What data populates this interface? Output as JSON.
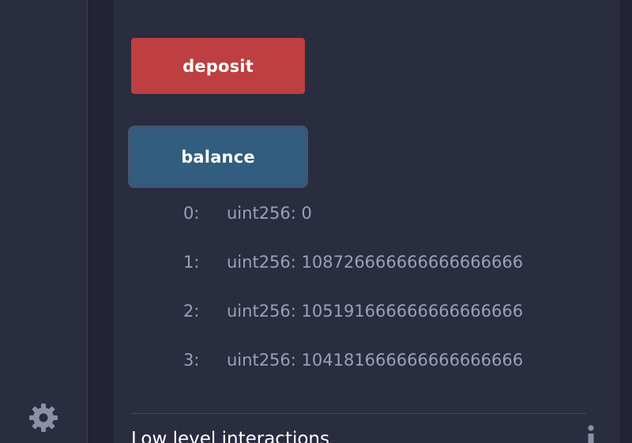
{
  "sidebar": {
    "settings_icon": "gear-icon"
  },
  "contract": {
    "deposit_label": "deposit",
    "balance_label": "balance",
    "colors": {
      "deposit": "#bd3f41",
      "balance": "#325d7e"
    },
    "results": [
      {
        "index": "0:",
        "value": "uint256: 0"
      },
      {
        "index": "1:",
        "value": "uint256: 108726666666666666666"
      },
      {
        "index": "2:",
        "value": "uint256: 105191666666666666666"
      },
      {
        "index": "3:",
        "value": "uint256: 104181666666666666666"
      }
    ]
  },
  "low_level": {
    "title": "Low level interactions",
    "info_icon": "info-icon"
  }
}
